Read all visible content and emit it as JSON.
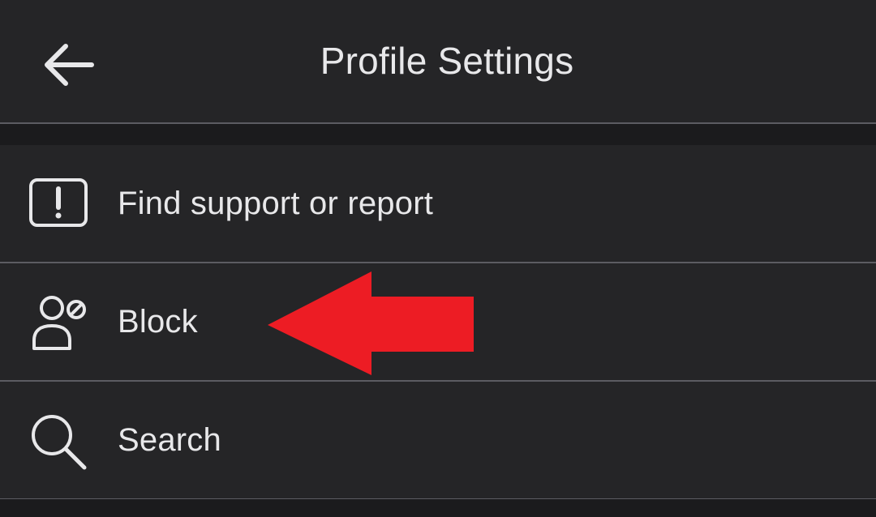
{
  "header": {
    "title": "Profile Settings",
    "back_icon": "arrow-left-icon"
  },
  "menu": {
    "items": [
      {
        "label": "Find support or report",
        "icon": "alert-box-icon"
      },
      {
        "label": "Block",
        "icon": "block-user-icon"
      },
      {
        "label": "Search",
        "icon": "search-icon"
      }
    ]
  },
  "annotation": {
    "type": "arrow-left",
    "color": "#ed1c24",
    "points_to": "Block"
  },
  "colors": {
    "surface": "#252527",
    "background": "#1b1b1d",
    "divider": "#5c5c62",
    "text": "#e8e8ea"
  }
}
